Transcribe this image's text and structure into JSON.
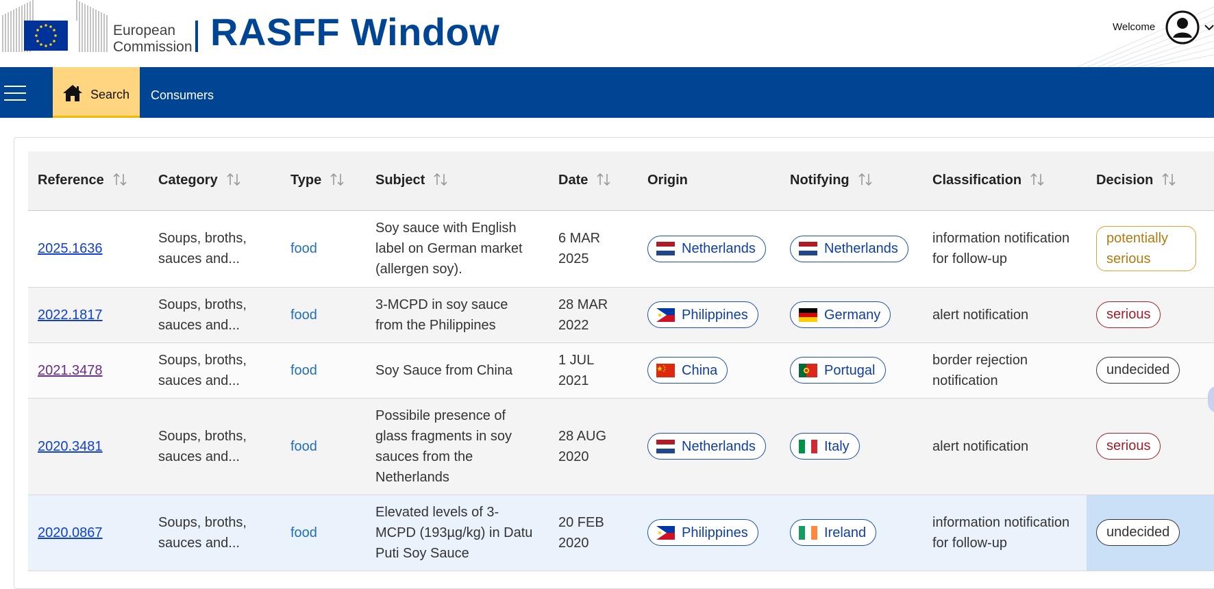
{
  "header": {
    "org_line1": "European",
    "org_line2": "Commission",
    "app_title": "RASFF Window",
    "welcome": "Welcome"
  },
  "nav": {
    "search_label": "Search",
    "consumers_label": "Consumers"
  },
  "table": {
    "columns": [
      "Reference",
      "Category",
      "Type",
      "Subject",
      "Date",
      "Origin",
      "Notifying",
      "Classification",
      "Decision"
    ],
    "rows": [
      {
        "reference": "2025.1636",
        "category_l1": "Soups, broths,",
        "category_l2": "sauces and...",
        "type": "food",
        "subject_lines": [
          "Soy sauce with English",
          "label on German market",
          "(allergen soy)."
        ],
        "date_l1": "6 MAR",
        "date_l2": "2025",
        "origin": "Netherlands",
        "notifying": "Netherlands",
        "class_l1": "information notification",
        "class_l2": "for follow-up",
        "decision_l1": "potentially",
        "decision_l2": "serious"
      },
      {
        "reference": "2022.1817",
        "category_l1": "Soups, broths,",
        "category_l2": "sauces and...",
        "type": "food",
        "subject_lines": [
          "3-MCPD in soy sauce",
          "from the Philippines"
        ],
        "date_l1": "28 MAR",
        "date_l2": "2022",
        "origin": "Philippines",
        "notifying": "Germany",
        "class_l1": "alert notification",
        "class_l2": "",
        "decision": "serious"
      },
      {
        "reference": "2021.3478",
        "category_l1": "Soups, broths,",
        "category_l2": "sauces and...",
        "type": "food",
        "subject_lines": [
          "Soy Sauce from China"
        ],
        "date_l1": "1 JUL",
        "date_l2": "2021",
        "origin": "China",
        "notifying": "Portugal",
        "class_l1": "border rejection",
        "class_l2": "notification",
        "decision": "undecided"
      },
      {
        "reference": "2020.3481",
        "category_l1": "Soups, broths,",
        "category_l2": "sauces and...",
        "type": "food",
        "subject_lines": [
          "Possibile presence of",
          "glass fragments in soy",
          "sauces from the",
          "Netherlands"
        ],
        "date_l1": "28 AUG",
        "date_l2": "2020",
        "origin": "Netherlands",
        "notifying": "Italy",
        "class_l1": "alert notification",
        "class_l2": "",
        "decision": "serious"
      },
      {
        "reference": "2020.0867",
        "category_l1": "Soups, broths,",
        "category_l2": "sauces and...",
        "type": "food",
        "subject_lines": [
          "Elevated levels of 3-",
          "MCPD (193µg/kg) in Datu",
          "Puti Soy Sauce"
        ],
        "date_l1": "20 FEB",
        "date_l2": "2020",
        "origin": "Philippines",
        "notifying": "Ireland",
        "class_l1": "information notification",
        "class_l2": "for follow-up",
        "decision": "undecided"
      }
    ]
  },
  "colors": {
    "brand_blue": "#004494",
    "search_tab": "#ffd580",
    "serious": "#a11d2b",
    "potentially_serious": "#e0a030",
    "link": "#0e3fd6"
  }
}
